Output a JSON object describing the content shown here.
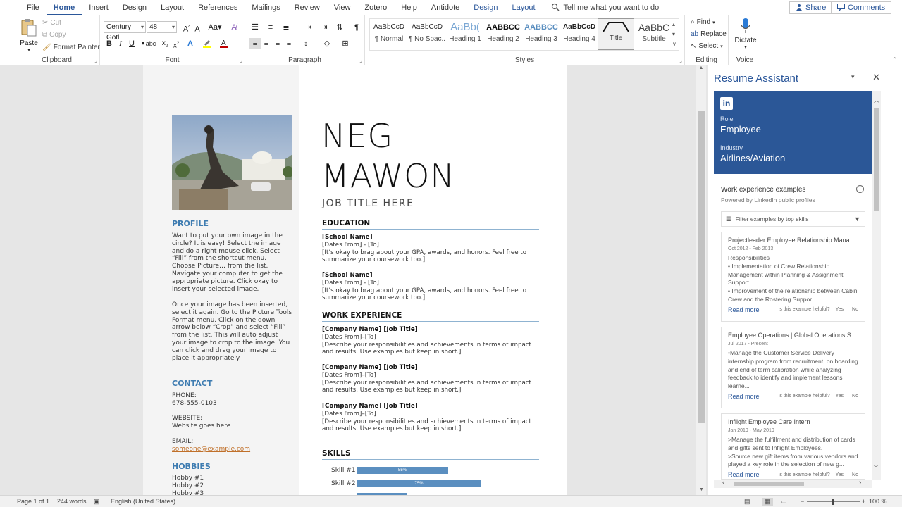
{
  "menu": {
    "items": [
      "File",
      "Home",
      "Insert",
      "Design",
      "Layout",
      "References",
      "Mailings",
      "Review",
      "View",
      "Zotero",
      "Help",
      "Antidote",
      "Design",
      "Layout"
    ],
    "tell_me": "Tell me what you want to do",
    "share": "Share",
    "comments": "Comments"
  },
  "ribbon": {
    "clipboard": {
      "label": "Clipboard",
      "paste": "Paste",
      "cut": "Cut",
      "copy": "Copy",
      "format_painter": "Format Painter"
    },
    "font": {
      "label": "Font",
      "family": "Century Gotl",
      "size": "48"
    },
    "paragraph": {
      "label": "Paragraph"
    },
    "styles": {
      "label": "Styles",
      "tiles": [
        {
          "preview": "AaBbCcD",
          "name": "¶ Normal"
        },
        {
          "preview": "AaBbCcD",
          "name": "¶ No Spac..."
        },
        {
          "preview": "AaBb(",
          "name": "Heading 1"
        },
        {
          "preview": "AABBCC",
          "name": "Heading 2"
        },
        {
          "preview": "AABBCC",
          "name": "Heading 3"
        },
        {
          "preview": "AaBbCcD",
          "name": "Heading 4"
        },
        {
          "preview": "",
          "name": "Title"
        },
        {
          "preview": "AaBbC",
          "name": "Subtitle"
        }
      ]
    },
    "editing": {
      "label": "Editing",
      "find": "Find",
      "replace": "Replace",
      "select": "Select"
    },
    "voice": {
      "label": "Voice",
      "dictate": "Dictate"
    }
  },
  "doc": {
    "name_line1": "NEG",
    "name_line2": "MAWON",
    "job_title": "JOB TITLE HERE",
    "sidebar": {
      "profile_heading": "PROFILE",
      "profile_p1": "Want to put your own image in the circle?  It is easy!  Select the image and do a right mouse click.  Select “Fill” from the shortcut menu.  Choose Picture… from the list.  Navigate your computer to get the appropriate picture.  Click okay to insert your selected image.",
      "profile_p2": "Once your image has been inserted, select it again.  Go to the Picture Tools Format menu. Click on the down arrow below “Crop” and select “Fill” from the list.  This will auto adjust your image to crop to the image.  You can click and drag your image to place it appropriately.",
      "contact_heading": "CONTACT",
      "phone_label": "PHONE:",
      "phone": "678-555-0103",
      "website_label": "WEBSITE:",
      "website": "Website goes here",
      "email_label": "EMAIL:",
      "email": "someone@example.com",
      "hobbies_heading": "HOBBIES",
      "hobbies": [
        "Hobby #1",
        "Hobby #2",
        "Hobby #3"
      ]
    },
    "education_heading": "EDUCATION",
    "education": [
      {
        "school": "[School Name]",
        "dates": "[Dates From] - [To]",
        "desc": "[It’s okay to brag about your GPA, awards, and honors. Feel free to summarize your coursework too.]"
      },
      {
        "school": "[School Name]",
        "dates": "[Dates From] - [To]",
        "desc": "[It’s okay to brag about your GPA, awards, and honors. Feel free to summarize your coursework too.]"
      }
    ],
    "work_heading": "WORK EXPERIENCE",
    "work": [
      {
        "title": "[Company Name]  [Job Title]",
        "dates": "[Dates From]–[To]",
        "desc": "[Describe your responsibilities and achievements in terms of impact and results. Use examples but keep in short.]"
      },
      {
        "title": "[Company Name]  [Job Title]",
        "dates": "[Dates From]–[To]",
        "desc": "[Describe your responsibilities and achievements in terms of impact and results. Use examples but keep in short.]"
      },
      {
        "title": "[Company Name]  [Job Title]",
        "dates": "[Dates From]–[To]",
        "desc": "[Describe your responsibilities and achievements in terms of impact and results. Use examples but keep in short.]"
      }
    ],
    "skills_heading": "SKILLS",
    "skills": [
      {
        "label": "Skill #1",
        "value": "55%",
        "fraction": 0.55
      },
      {
        "label": "Skill #2",
        "value": "75%",
        "fraction": 0.75
      },
      {
        "label": "Skill #3",
        "value": "",
        "fraction": 0.3
      }
    ]
  },
  "pane": {
    "title": "Resume Assistant",
    "role_label": "Role",
    "role": "Employee",
    "industry_label": "Industry",
    "industry": "Airlines/Aviation",
    "examples_heading": "Work experience examples",
    "powered_by": "Powered by LinkedIn public profiles",
    "filter_placeholder": "Filter examples by top skills",
    "cards": [
      {
        "title": "Projectleader Employee Relationship Manage...",
        "dates": "Oct 2012 - Feb 2013",
        "body": "Responsibilities\n• Implementation of Crew Relationship Management within Planning & Assignment Support\n• Improvement of the relationship between Cabin Crew and the Rostering Suppor...",
        "read_more": "Read more",
        "helpful": "Is this example helpful?",
        "yes": "Yes",
        "no": "No"
      },
      {
        "title": "Employee Operations | Global Operations Strat...",
        "dates": "Jul 2017 - Present",
        "body": "•Manage the Customer Service Delivery internship program from recruitment, on boarding and end of term calibration while analyzing feedback to identify and implement lessons learne...",
        "read_more": "Read more",
        "helpful": "Is this example helpful?",
        "yes": "Yes",
        "no": "No"
      },
      {
        "title": "Inflight Employee Care Intern",
        "dates": "Jan 2019 - May 2019",
        "body": ">Manage the fulfillment and distribution of cards and gifts sent to Inflight Employees.\n>Source new gift items from various vendors and played a key role in the selection of new g...",
        "read_more": "Read more",
        "helpful": "Is this example helpful?",
        "yes": "Yes",
        "no": "No"
      }
    ]
  },
  "status": {
    "page": "Page 1 of 1",
    "words": "244 words",
    "language": "English (United States)",
    "zoom": "100 %"
  },
  "colors": {
    "accent": "#2b579a",
    "linkedin": "#2b5797",
    "sidebar_heading": "#3e7cb1",
    "skill_bar": "#5b8fc0"
  }
}
